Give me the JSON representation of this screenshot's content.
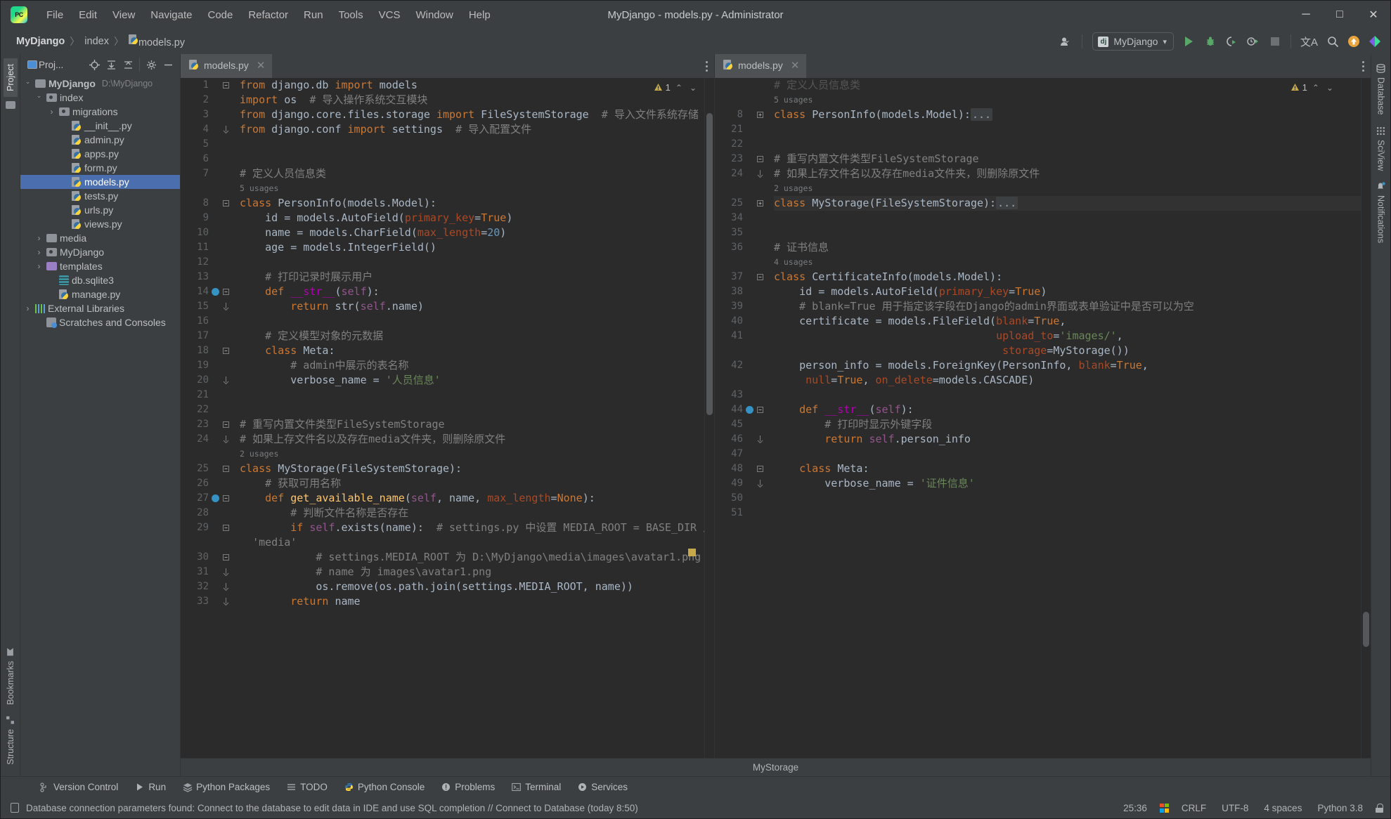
{
  "window": {
    "title": "MyDjango - models.py - Administrator",
    "logo_text": "PC",
    "minimize": "─",
    "maximize": "□",
    "close": "✕"
  },
  "menubar": {
    "items": [
      {
        "label": "File"
      },
      {
        "label": "Edit"
      },
      {
        "label": "View"
      },
      {
        "label": "Navigate"
      },
      {
        "label": "Code"
      },
      {
        "label": "Refactor"
      },
      {
        "label": "Run"
      },
      {
        "label": "Tools"
      },
      {
        "label": "VCS"
      },
      {
        "label": "Window"
      },
      {
        "label": "Help"
      }
    ]
  },
  "breadcrumb": {
    "project": "MyDjango",
    "sep": "〉",
    "folder": "index",
    "file": "models.py"
  },
  "toolbar": {
    "run_config": "MyDjango",
    "django_badge": "dj",
    "chevron": "▾",
    "user_icon": "user-profile",
    "translate_icon": "文A",
    "search_icon": "⌕",
    "update_icon": "↑",
    "ai_icon": "AI"
  },
  "left_rail": {
    "project_tab": "Project",
    "bookmarks_tab": "Bookmarks",
    "structure_tab": "Structure"
  },
  "right_rail": {
    "database_tab": "Database",
    "sciview_tab": "SciView",
    "notifications_tab": "Notifications"
  },
  "project_panel": {
    "title": "Proj...",
    "buttons": [
      "locate-icon",
      "expand-all-icon",
      "collapse-all-icon",
      "settings-icon",
      "hide-icon"
    ],
    "tree": [
      {
        "indent": 0,
        "arrow": "open",
        "icon": "folder",
        "name": "MyDjango",
        "path": "D:\\MyDjango",
        "bold": true,
        "selected": false
      },
      {
        "indent": 1,
        "arrow": "open",
        "icon": "folder-module",
        "name": "index",
        "path": "",
        "bold": false,
        "selected": false
      },
      {
        "indent": 2,
        "arrow": "closed",
        "icon": "folder-module",
        "name": "migrations",
        "path": "",
        "bold": false,
        "selected": false
      },
      {
        "indent": 3,
        "arrow": "none",
        "icon": "python",
        "name": "__init__.py",
        "path": "",
        "bold": false,
        "selected": false
      },
      {
        "indent": 3,
        "arrow": "none",
        "icon": "python",
        "name": "admin.py",
        "path": "",
        "bold": false,
        "selected": false
      },
      {
        "indent": 3,
        "arrow": "none",
        "icon": "python",
        "name": "apps.py",
        "path": "",
        "bold": false,
        "selected": false
      },
      {
        "indent": 3,
        "arrow": "none",
        "icon": "python",
        "name": "form.py",
        "path": "",
        "bold": false,
        "selected": false
      },
      {
        "indent": 3,
        "arrow": "none",
        "icon": "python",
        "name": "models.py",
        "path": "",
        "bold": false,
        "selected": true
      },
      {
        "indent": 3,
        "arrow": "none",
        "icon": "python",
        "name": "tests.py",
        "path": "",
        "bold": false,
        "selected": false
      },
      {
        "indent": 3,
        "arrow": "none",
        "icon": "python",
        "name": "urls.py",
        "path": "",
        "bold": false,
        "selected": false
      },
      {
        "indent": 3,
        "arrow": "none",
        "icon": "python",
        "name": "views.py",
        "path": "",
        "bold": false,
        "selected": false
      },
      {
        "indent": 1,
        "arrow": "closed",
        "icon": "folder",
        "name": "media",
        "path": "",
        "bold": false,
        "selected": false
      },
      {
        "indent": 1,
        "arrow": "closed",
        "icon": "folder-module",
        "name": "MyDjango",
        "path": "",
        "bold": false,
        "selected": false
      },
      {
        "indent": 1,
        "arrow": "closed",
        "icon": "folder-purple",
        "name": "templates",
        "path": "",
        "bold": false,
        "selected": false
      },
      {
        "indent": 2,
        "arrow": "none",
        "icon": "database",
        "name": "db.sqlite3",
        "path": "",
        "bold": false,
        "selected": false
      },
      {
        "indent": 2,
        "arrow": "none",
        "icon": "python",
        "name": "manage.py",
        "path": "",
        "bold": false,
        "selected": false
      },
      {
        "indent": 0,
        "arrow": "closed",
        "icon": "libraries",
        "name": "External Libraries",
        "path": "",
        "bold": false,
        "selected": false
      },
      {
        "indent": 1,
        "arrow": "none",
        "icon": "scratches",
        "name": "Scratches and Consoles",
        "path": "",
        "bold": false,
        "selected": false
      }
    ]
  },
  "left_editor": {
    "tab": {
      "label": "models.py",
      "close": "✕"
    },
    "warning_count": "1",
    "warning_icon": "warning-triangle",
    "up_chevron": "⌃",
    "down_chevron": "⌄",
    "lines": [
      {
        "num": "1",
        "fold": "open-top",
        "bp": false,
        "html": "<span class=\"kw\">from</span> django.db <span class=\"kw\">import</span> models"
      },
      {
        "num": "2",
        "fold": "",
        "bp": false,
        "html": "<span class=\"kw\">import</span> os  <span class=\"cmt\"># 导入操作系统交互模块</span>"
      },
      {
        "num": "3",
        "fold": "",
        "bp": false,
        "html": "<span class=\"kw\">from</span> django.core.files.storage <span class=\"kw\">import</span> FileSystemStorage  <span class=\"cmt\"># 导入文件系统存储</span>"
      },
      {
        "num": "4",
        "fold": "end",
        "bp": false,
        "html": "<span class=\"kw\">from</span> django.conf <span class=\"kw\">import</span> settings  <span class=\"cmt\"># 导入配置文件</span>"
      },
      {
        "num": "5",
        "fold": "",
        "bp": false,
        "html": ""
      },
      {
        "num": "6",
        "fold": "",
        "bp": false,
        "html": ""
      },
      {
        "num": "7",
        "fold": "",
        "bp": false,
        "html": "<span class=\"cmt\"># 定义人员信息类</span>"
      },
      {
        "num": "",
        "fold": "",
        "bp": false,
        "usage": "5 usages"
      },
      {
        "num": "8",
        "fold": "open",
        "bp": false,
        "html": "<span class=\"kw\">class</span> <span class=\"cls\">PersonInfo</span>(models.Model):"
      },
      {
        "num": "9",
        "fold": "",
        "bp": false,
        "html": "    id = models.AutoField(<span class=\"kwarg\">primary_key</span>=<span class=\"kw\">True</span>)"
      },
      {
        "num": "10",
        "fold": "",
        "bp": false,
        "html": "    name = models.CharField(<span class=\"kwarg\">max_length</span>=<span class=\"num\">20</span>)"
      },
      {
        "num": "11",
        "fold": "",
        "bp": false,
        "html": "    age = models.IntegerField()"
      },
      {
        "num": "12",
        "fold": "",
        "bp": false,
        "html": ""
      },
      {
        "num": "13",
        "fold": "",
        "bp": false,
        "html": "    <span class=\"cmt\"># 打印记录时展示用户</span>"
      },
      {
        "num": "14",
        "fold": "open",
        "bp": true,
        "html": "    <span class=\"kw\">def</span> <span class=\"magic\">__str__</span>(<span class=\"self\">self</span>):"
      },
      {
        "num": "15",
        "fold": "close",
        "bp": false,
        "html": "        <span class=\"kw\">return</span> str(<span class=\"self\">self</span>.name)"
      },
      {
        "num": "16",
        "fold": "",
        "bp": false,
        "html": ""
      },
      {
        "num": "17",
        "fold": "",
        "bp": false,
        "html": "    <span class=\"cmt\"># 定义模型对象的元数据</span>"
      },
      {
        "num": "18",
        "fold": "open",
        "bp": false,
        "html": "    <span class=\"kw\">class</span> <span class=\"cls\">Meta</span>:"
      },
      {
        "num": "19",
        "fold": "",
        "bp": false,
        "html": "        <span class=\"cmt\"># admin中展示的表名称</span>"
      },
      {
        "num": "20",
        "fold": "close",
        "bp": false,
        "html": "        verbose_name = <span class=\"str\">'人员信息'</span>"
      },
      {
        "num": "21",
        "fold": "",
        "bp": false,
        "html": ""
      },
      {
        "num": "22",
        "fold": "",
        "bp": false,
        "html": ""
      },
      {
        "num": "23",
        "fold": "open-top",
        "bp": false,
        "html": "<span class=\"cmt\"># 重写内置文件类型FileSystemStorage</span>"
      },
      {
        "num": "24",
        "fold": "end",
        "bp": false,
        "html": "<span class=\"cmt\"># 如果上存文件名以及存在media文件夹，则删除原文件</span>"
      },
      {
        "num": "",
        "fold": "",
        "bp": false,
        "usage": "2 usages"
      },
      {
        "num": "25",
        "fold": "open",
        "bp": false,
        "html": "<span class=\"kw\">class</span> <span class=\"cls\">MyStorage</span>(FileSystemStorage):"
      },
      {
        "num": "26",
        "fold": "",
        "bp": false,
        "html": "    <span class=\"cmt\"># 获取可用名称</span>"
      },
      {
        "num": "27",
        "fold": "open",
        "bp": true,
        "html": "    <span class=\"kw\">def</span> <span class=\"fn\">get_available_name</span>(<span class=\"self\">self</span>, name, <span class=\"kwarg\">max_length</span>=<span class=\"kw\">None</span>):"
      },
      {
        "num": "28",
        "fold": "",
        "bp": false,
        "html": "        <span class=\"cmt\"># 判断文件名称是否存在</span>"
      },
      {
        "num": "29",
        "fold": "open",
        "bp": false,
        "html": "        <span class=\"kw\">if</span> <span class=\"self\">self</span>.exists(name):  <span class=\"cmt\"># settings.py 中设置 MEDIA_ROOT = BASE_DIR /</span>"
      },
      {
        "num": "",
        "fold": "",
        "bp": false,
        "cont": "  <span class=\"cmt\">'media'</span>"
      },
      {
        "num": "30",
        "fold": "open",
        "bp": false,
        "html": "            <span class=\"cmt\"># settings.MEDIA_ROOT 为 D:\\MyDjango\\media\\images\\avatar1.png</span>"
      },
      {
        "num": "31",
        "fold": "close",
        "bp": false,
        "html": "            <span class=\"cmt\"># name 为 images\\avatar1.png</span>"
      },
      {
        "num": "32",
        "fold": "close",
        "bp": false,
        "html": "            os.remove(os.path.join(settings.MEDIA_ROOT, name))"
      },
      {
        "num": "33",
        "fold": "close",
        "bp": false,
        "html": "        <span class=\"kw\">return</span> name"
      }
    ]
  },
  "right_editor": {
    "tab": {
      "label": "models.py",
      "close": "✕"
    },
    "warning_count": "1",
    "warning_icon": "warning-triangle",
    "up_chevron": "⌃",
    "down_chevron": "⌄",
    "lines": [
      {
        "num": "",
        "fold": "",
        "bp": false,
        "html": "<span class=\"cmt\"># 定义人员信息类</span>",
        "clipped": true
      },
      {
        "num": "",
        "fold": "",
        "bp": false,
        "usage": "5 usages"
      },
      {
        "num": "8",
        "fold": "collapsed",
        "bp": false,
        "html": "<span class=\"kw\">class</span> <span class=\"cls\">PersonInfo</span>(models.Model):<span class=\"dots\">...</span>"
      },
      {
        "num": "21",
        "fold": "",
        "bp": false,
        "html": ""
      },
      {
        "num": "22",
        "fold": "",
        "bp": false,
        "html": ""
      },
      {
        "num": "23",
        "fold": "open-top",
        "bp": false,
        "html": "<span class=\"cmt\"># 重写内置文件类型FileSystemStorage</span>"
      },
      {
        "num": "24",
        "fold": "end",
        "bp": false,
        "html": "<span class=\"cmt\"># 如果上存文件名以及存在media文件夹，则删除原文件</span>"
      },
      {
        "num": "",
        "fold": "",
        "bp": false,
        "usage": "2 usages"
      },
      {
        "num": "25",
        "fold": "collapsed",
        "bp": false,
        "html": "<span class=\"kw\">class</span> <span class=\"cls\">MyStorage</span>(FileSystemStorage):<span class=\"dots\">...</span>",
        "highlight": true
      },
      {
        "num": "34",
        "fold": "",
        "bp": false,
        "html": ""
      },
      {
        "num": "35",
        "fold": "",
        "bp": false,
        "html": ""
      },
      {
        "num": "36",
        "fold": "",
        "bp": false,
        "html": "<span class=\"cmt\"># 证书信息</span>"
      },
      {
        "num": "",
        "fold": "",
        "bp": false,
        "usage": "4 usages"
      },
      {
        "num": "37",
        "fold": "open",
        "bp": false,
        "html": "<span class=\"kw\">class</span> <span class=\"cls\">CertificateInfo</span>(models.Model):"
      },
      {
        "num": "38",
        "fold": "",
        "bp": false,
        "html": "    id = models.AutoField(<span class=\"kwarg\">primary_key</span>=<span class=\"kw\">True</span>)"
      },
      {
        "num": "39",
        "fold": "",
        "bp": false,
        "html": "    <span class=\"cmt\"># blank=True 用于指定该字段在Django的admin界面或表单验证中是否可以为空</span>"
      },
      {
        "num": "40",
        "fold": "",
        "bp": false,
        "html": "    certificate = models.FileField(<span class=\"kwarg\">blank</span>=<span class=\"kw\">True</span>,"
      },
      {
        "num": "41",
        "fold": "",
        "bp": false,
        "html": "                                   <span class=\"kwarg\">upload_to</span>=<span class=\"str\">'images/'</span>,"
      },
      {
        "num": "",
        "fold": "",
        "bp": false,
        "cont": "                                    <span class=\"kwarg\">storage</span>=MyStorage())"
      },
      {
        "num": "42",
        "fold": "",
        "bp": false,
        "html": "    person_info = models.ForeignKey(PersonInfo, <span class=\"kwarg\">blank</span>=<span class=\"kw\">True</span>,"
      },
      {
        "num": "",
        "fold": "",
        "bp": false,
        "cont": "     <span class=\"kwarg\">null</span>=<span class=\"kw\">True</span>, <span class=\"kwarg\">on_delete</span>=models.CASCADE)"
      },
      {
        "num": "43",
        "fold": "",
        "bp": false,
        "html": ""
      },
      {
        "num": "44",
        "fold": "open",
        "bp": true,
        "html": "    <span class=\"kw\">def</span> <span class=\"magic\">__str__</span>(<span class=\"self\">self</span>):"
      },
      {
        "num": "45",
        "fold": "",
        "bp": false,
        "html": "        <span class=\"cmt\"># 打印时显示外键字段</span>"
      },
      {
        "num": "46",
        "fold": "close",
        "bp": false,
        "html": "        <span class=\"kw\">return</span> <span class=\"self\">self</span>.person_info"
      },
      {
        "num": "47",
        "fold": "",
        "bp": false,
        "html": ""
      },
      {
        "num": "48",
        "fold": "open",
        "bp": false,
        "html": "    <span class=\"kw\">class</span> <span class=\"cls\">Meta</span>:"
      },
      {
        "num": "49",
        "fold": "close",
        "bp": false,
        "html": "        verbose_name = <span class=\"str\">'证件信息'</span>"
      },
      {
        "num": "50",
        "fold": "",
        "bp": false,
        "html": ""
      },
      {
        "num": "51",
        "fold": "",
        "bp": false,
        "html": ""
      }
    ]
  },
  "editor_footer": {
    "breadcrumb": "MyStorage"
  },
  "bottom_toolbar": {
    "items": [
      {
        "label": "Version Control",
        "icon": "branch-icon"
      },
      {
        "label": "Run",
        "icon": "play-icon"
      },
      {
        "label": "Python Packages",
        "icon": "packages-icon"
      },
      {
        "label": "TODO",
        "icon": "list-icon"
      },
      {
        "label": "Python Console",
        "icon": "python-icon"
      },
      {
        "label": "Problems",
        "icon": "problems-icon"
      },
      {
        "label": "Terminal",
        "icon": "terminal-icon"
      },
      {
        "label": "Services",
        "icon": "services-icon"
      }
    ]
  },
  "statusbar": {
    "message": "Database connection parameters found: Connect to the database to edit data in IDE and use SQL completion // Connect to Database (today 8:50)",
    "message_icon": "database-doc-icon",
    "caret_position": "25:36",
    "os_icon": "windows-icon",
    "line_separator": "CRLF",
    "encoding": "UTF-8",
    "indent": "4 spaces",
    "interpreter": "Python 3.8",
    "lock_icon": "lock-icon"
  }
}
